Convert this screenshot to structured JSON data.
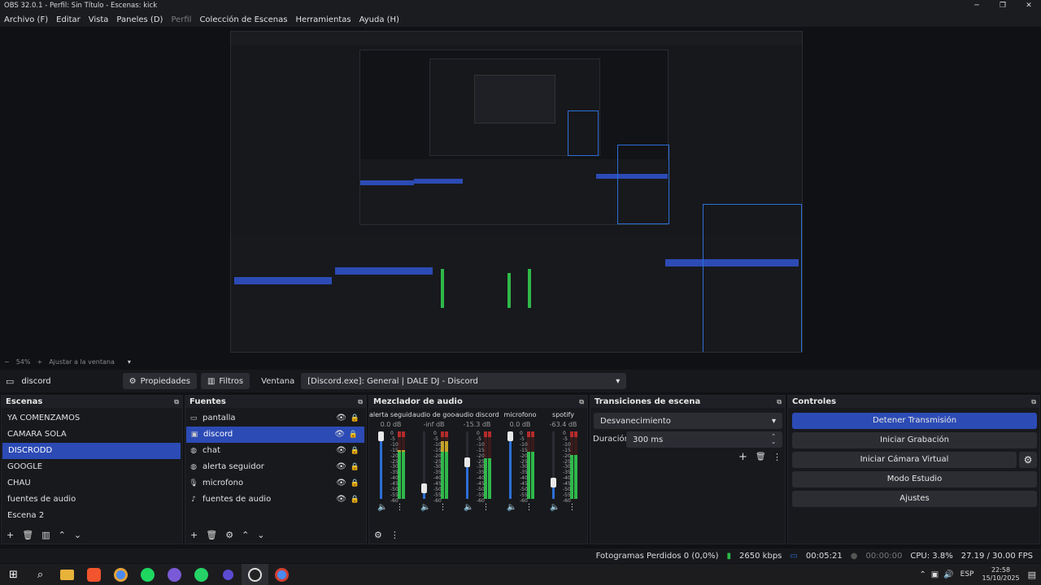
{
  "window": {
    "title": "OBS 32.0.1 - Perfil: Sin Título - Escenas: kick",
    "minimize": "─",
    "restore": "❐",
    "close": "✕"
  },
  "menu": {
    "archivo": "Archivo (F)",
    "editar": "Editar",
    "vista": "Vista",
    "paneles": "Paneles (D)",
    "perfil": "Perfil",
    "coleccion": "Colección de Escenas",
    "herramientas": "Herramientas",
    "ayuda": "Ayuda (H)"
  },
  "zoom": {
    "minus": "−",
    "level": "54%",
    "plus": "+",
    "fit": "Ajustar a la ventana",
    "dropdown": "▾"
  },
  "context": {
    "source_name": "discord",
    "properties": "Propiedades",
    "filters": "Filtros",
    "window_label": "Ventana",
    "window_value": "[Discord.exe]: General | DALE DJ - Discord"
  },
  "scenes": {
    "title": "Escenas",
    "items": [
      "YA COMENZAMOS",
      "CAMARA SOLA",
      "DISCRODD",
      "GOOGLE",
      "CHAU",
      "fuentes de audio",
      "Escena 2"
    ],
    "selected_index": 2
  },
  "sources": {
    "title": "Fuentes",
    "items": [
      {
        "label": "pantalla",
        "icon": "monitor-icon"
      },
      {
        "label": "discord",
        "icon": "window-icon"
      },
      {
        "label": "chat",
        "icon": "browser-icon"
      },
      {
        "label": "alerta seguidor",
        "icon": "browser-icon"
      },
      {
        "label": "microfono",
        "icon": "microphone-icon"
      },
      {
        "label": "fuentes de audio",
        "icon": "audio-icon"
      }
    ],
    "selected_index": 1
  },
  "mixer": {
    "title": "Mezclador de audio",
    "channels": [
      {
        "name": "alerta seguidor",
        "db": "0.0 dB",
        "fader": 1.0,
        "level": 0.72
      },
      {
        "name": "audio de google",
        "db": "-inf dB",
        "fader": 0.1,
        "level": 0.85
      },
      {
        "name": "audio discord",
        "db": "-15.3 dB",
        "fader": 0.55,
        "level": 0.6
      },
      {
        "name": "microfono",
        "db": "0.0 dB",
        "fader": 1.0,
        "level": 0.7
      },
      {
        "name": "spotify",
        "db": "-63.4 dB",
        "fader": 0.2,
        "level": 0.65
      }
    ],
    "scale": [
      "0",
      "-5",
      "-10",
      "-15",
      "-20",
      "-25",
      "-30",
      "-35",
      "-40",
      "-45",
      "-50",
      "-55",
      "-60"
    ]
  },
  "transitions": {
    "title": "Transiciones de escena",
    "selected": "Desvanecimiento",
    "duration_label": "Duración",
    "duration_value": "300 ms"
  },
  "controls": {
    "title": "Controles",
    "stop_stream": "Detener Transmisión",
    "start_recording": "Iniciar Grabación",
    "start_virtual_cam": "Iniciar Cámara Virtual",
    "studio_mode": "Modo Estudio",
    "settings": "Ajustes"
  },
  "status": {
    "dropped": "Fotogramas Perdidos 0 (0,0%)",
    "bitrate": "2650 kbps",
    "stream_time": "00:05:21",
    "rec_time": "00:00:00",
    "cpu": "CPU: 3.8%",
    "fps": "27.19 / 30.00 FPS"
  },
  "taskbar": {
    "lang": "ESP",
    "time": "22:58",
    "date": "15/10/2025"
  },
  "colors": {
    "accent": "#2c4bb5",
    "meter_green": "#2fb84a",
    "meter_yellow": "#c7a227",
    "meter_red": "#b52a2a"
  }
}
